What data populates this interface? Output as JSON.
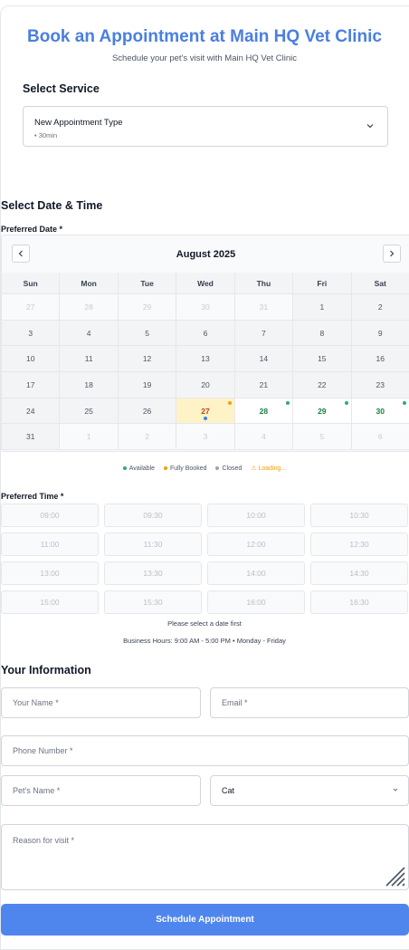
{
  "header": {
    "title": "Book an Appointment at Main HQ Vet Clinic",
    "subtitle": "Schedule your pet's visit with Main HQ Vet Clinic"
  },
  "service": {
    "section_title": "Select Service",
    "selected_name": "New Appointment Type",
    "selected_duration": "• 30min"
  },
  "datetime": {
    "section_title": "Select Date & Time",
    "date_label": "Preferred Date *",
    "month": "August 2025",
    "prev_icon": "chevron-left-icon",
    "next_icon": "chevron-right-icon",
    "weekdays": [
      "Sun",
      "Mon",
      "Tue",
      "Wed",
      "Thu",
      "Fri",
      "Sat"
    ],
    "weeks": [
      [
        {
          "d": "27",
          "s": "other"
        },
        {
          "d": "28",
          "s": "other"
        },
        {
          "d": "29",
          "s": "other"
        },
        {
          "d": "30",
          "s": "other"
        },
        {
          "d": "31",
          "s": "other"
        },
        {
          "d": "1",
          "s": "past"
        },
        {
          "d": "2",
          "s": "past"
        }
      ],
      [
        {
          "d": "3",
          "s": "past"
        },
        {
          "d": "4",
          "s": "past"
        },
        {
          "d": "5",
          "s": "past"
        },
        {
          "d": "6",
          "s": "past"
        },
        {
          "d": "7",
          "s": "past"
        },
        {
          "d": "8",
          "s": "past"
        },
        {
          "d": "9",
          "s": "past"
        }
      ],
      [
        {
          "d": "10",
          "s": "past"
        },
        {
          "d": "11",
          "s": "past"
        },
        {
          "d": "12",
          "s": "past"
        },
        {
          "d": "13",
          "s": "past"
        },
        {
          "d": "14",
          "s": "past"
        },
        {
          "d": "15",
          "s": "past"
        },
        {
          "d": "16",
          "s": "past"
        }
      ],
      [
        {
          "d": "17",
          "s": "past"
        },
        {
          "d": "18",
          "s": "past"
        },
        {
          "d": "19",
          "s": "past"
        },
        {
          "d": "20",
          "s": "past"
        },
        {
          "d": "21",
          "s": "past"
        },
        {
          "d": "22",
          "s": "past"
        },
        {
          "d": "23",
          "s": "past"
        }
      ],
      [
        {
          "d": "24",
          "s": "past"
        },
        {
          "d": "25",
          "s": "past"
        },
        {
          "d": "26",
          "s": "past"
        },
        {
          "d": "27",
          "s": "today",
          "dot": "orange"
        },
        {
          "d": "28",
          "s": "avail",
          "dot": "green"
        },
        {
          "d": "29",
          "s": "avail",
          "dot": "green"
        },
        {
          "d": "30",
          "s": "avail",
          "dot": "green"
        }
      ],
      [
        {
          "d": "31",
          "s": "past"
        },
        {
          "d": "1",
          "s": "other"
        },
        {
          "d": "2",
          "s": "other"
        },
        {
          "d": "3",
          "s": "other"
        },
        {
          "d": "4",
          "s": "other"
        },
        {
          "d": "5",
          "s": "other"
        },
        {
          "d": "6",
          "s": "other"
        }
      ]
    ],
    "legend": {
      "available": "Available",
      "fully_booked": "Fully Booked",
      "closed": "Closed",
      "loading": "⚠ Loading..."
    },
    "time_label": "Preferred Time *",
    "time_slots": [
      "09:00",
      "09:30",
      "10:00",
      "10:30",
      "11:00",
      "11:30",
      "12:00",
      "12:30",
      "13:00",
      "13:30",
      "14:00",
      "14:30",
      "15:00",
      "15:30",
      "16:00",
      "16:30"
    ],
    "hint": "Please select a date first",
    "business_hours": "Business Hours: 9:00 AM - 5:00 PM • Monday - Friday"
  },
  "info": {
    "section_title": "Your Information",
    "name_placeholder": "Your Name *",
    "email_placeholder": "Email *",
    "phone_placeholder": "Phone Number *",
    "pet_name_placeholder": "Pet's Name *",
    "pet_type_value": "Cat",
    "reason_placeholder": "Reason for visit *"
  },
  "submit_label": "Schedule Appointment",
  "colors": {
    "accent": "#4a7fe0",
    "available": "#34a870",
    "booked": "#f59e0b",
    "closed": "#9ca3af"
  }
}
